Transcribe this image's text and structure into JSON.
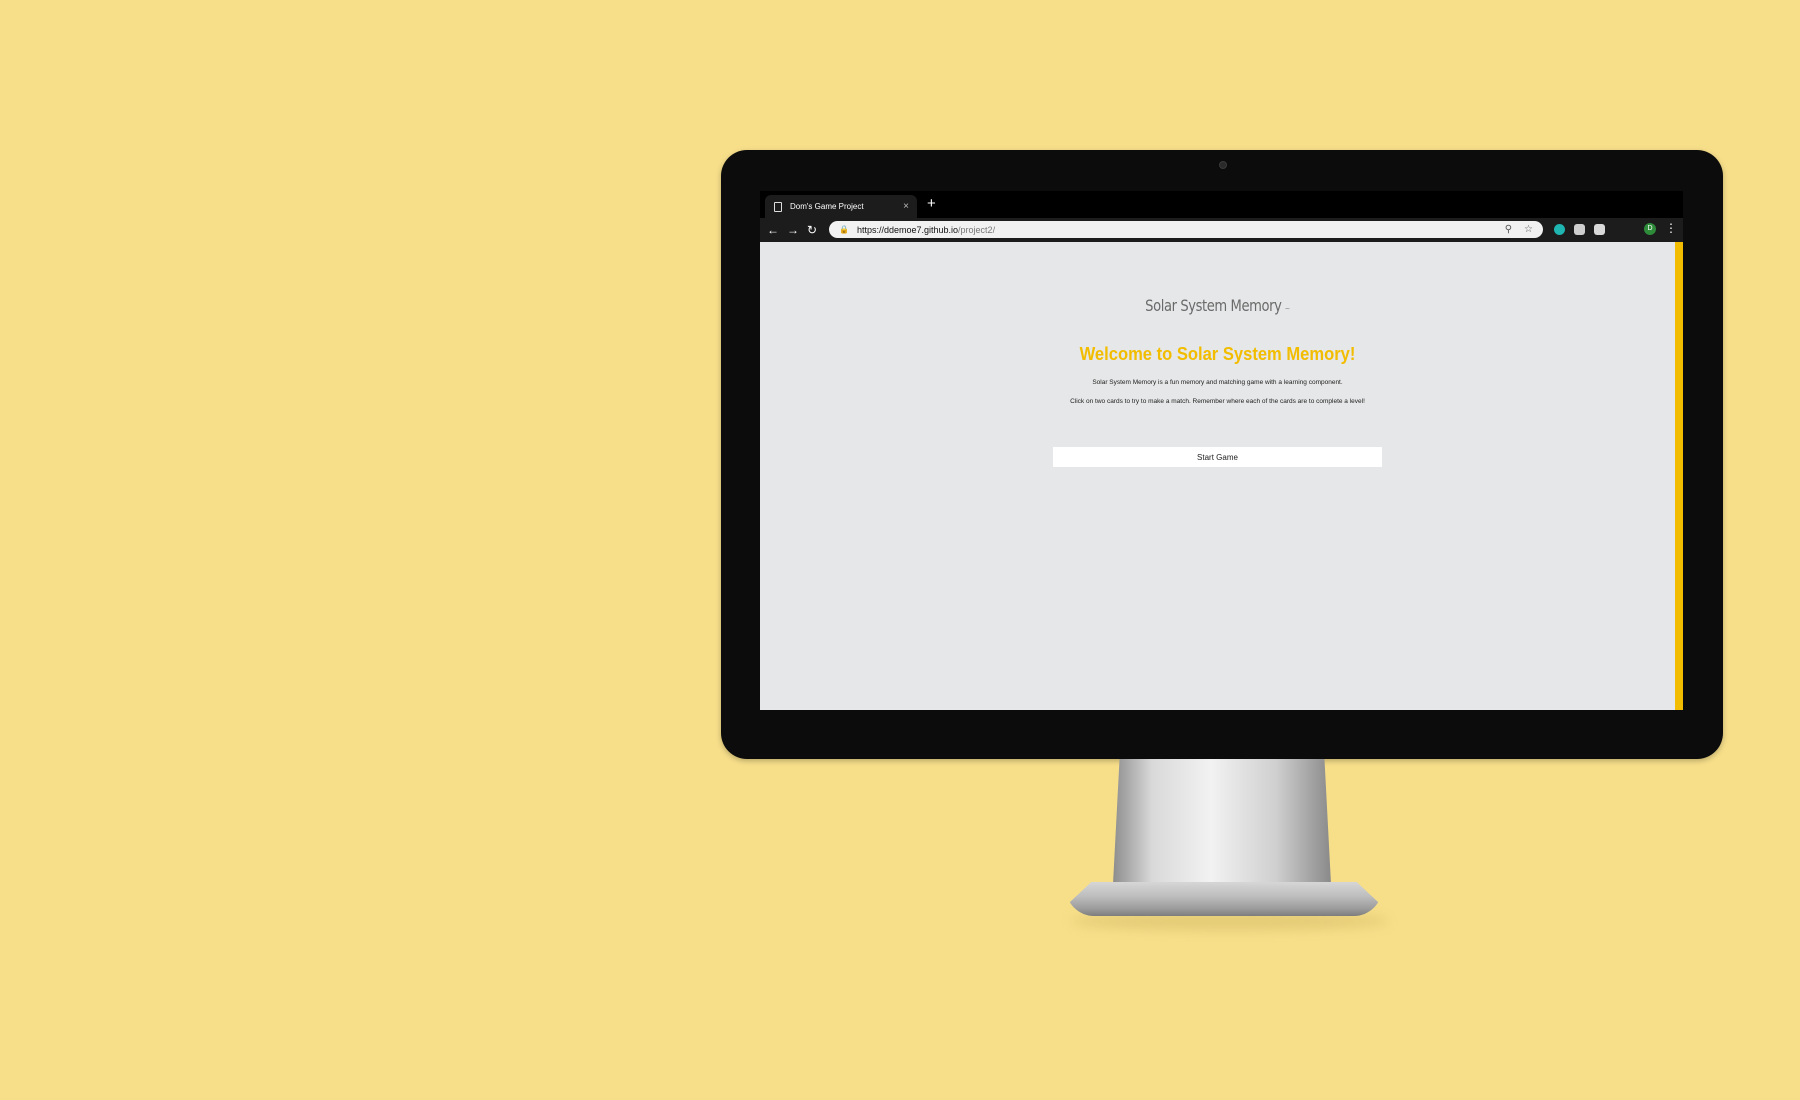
{
  "browser": {
    "tab_title": "Dom's Game Project",
    "tab_close": "×",
    "new_tab": "+",
    "url_host": "https://ddemoe7.github.io",
    "url_path": "/project2/",
    "profile_initial": "D"
  },
  "page": {
    "logo": "Solar System Memory",
    "heading": "Welcome to Solar System Memory!",
    "description_1": "Solar System Memory is a fun memory and matching game with a learning component.",
    "description_2": "Click on two cards to try to make a match. Remember where each of the cards are to complete a level!",
    "start_button": "Start Game"
  },
  "colors": {
    "background": "#f7df8a",
    "accent": "#f2bd00",
    "page_bg": "#e6e7e8"
  },
  "icons": [
    "document-icon",
    "back-arrow-icon",
    "forward-arrow-icon",
    "reload-icon",
    "lock-icon",
    "search-icon",
    "star-icon",
    "extension-icon",
    "profile-avatar",
    "menu-dots-icon"
  ]
}
